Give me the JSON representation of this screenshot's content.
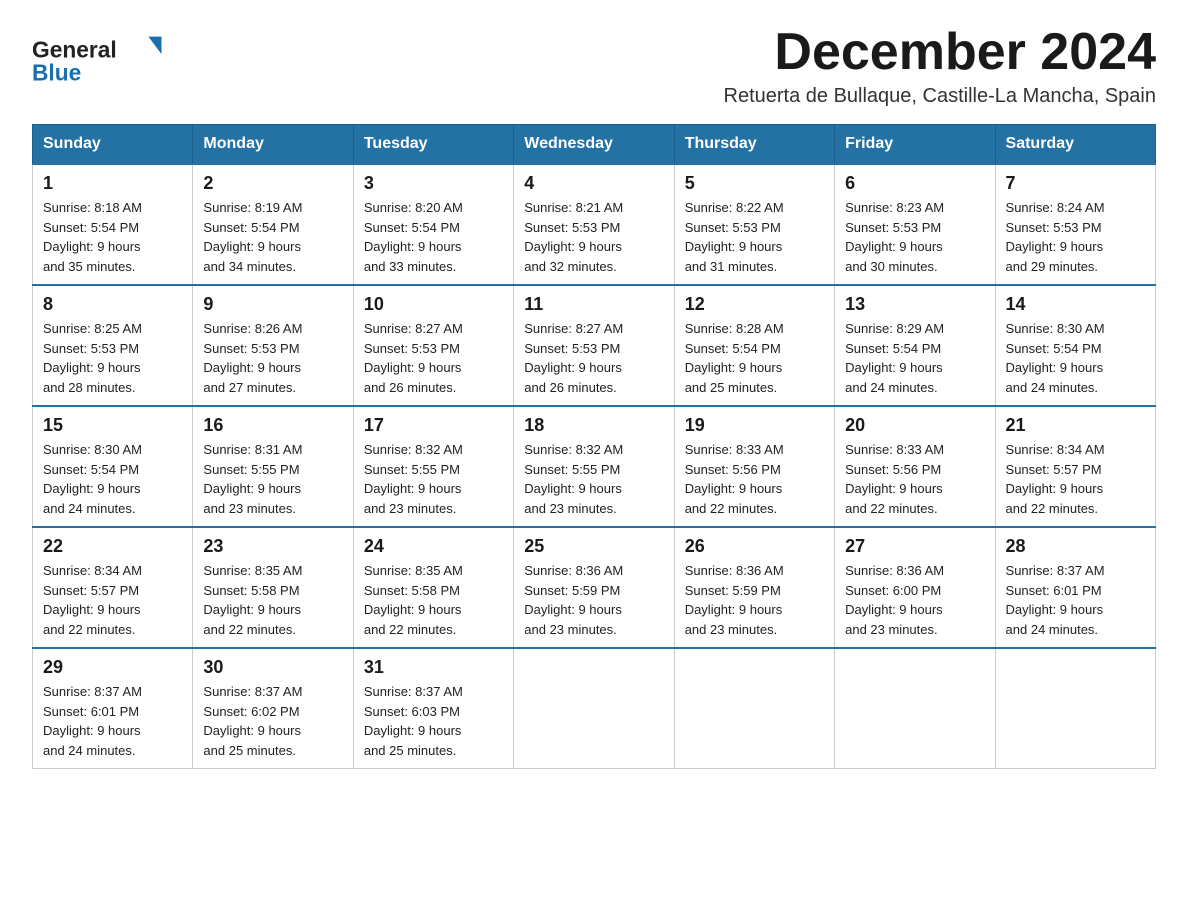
{
  "header": {
    "logo_general": "General",
    "logo_blue": "Blue",
    "title": "December 2024",
    "location": "Retuerta de Bullaque, Castille-La Mancha, Spain"
  },
  "calendar": {
    "days_of_week": [
      "Sunday",
      "Monday",
      "Tuesday",
      "Wednesday",
      "Thursday",
      "Friday",
      "Saturday"
    ],
    "weeks": [
      [
        {
          "day": "1",
          "sunrise": "8:18 AM",
          "sunset": "5:54 PM",
          "daylight": "9 hours and 35 minutes."
        },
        {
          "day": "2",
          "sunrise": "8:19 AM",
          "sunset": "5:54 PM",
          "daylight": "9 hours and 34 minutes."
        },
        {
          "day": "3",
          "sunrise": "8:20 AM",
          "sunset": "5:54 PM",
          "daylight": "9 hours and 33 minutes."
        },
        {
          "day": "4",
          "sunrise": "8:21 AM",
          "sunset": "5:53 PM",
          "daylight": "9 hours and 32 minutes."
        },
        {
          "day": "5",
          "sunrise": "8:22 AM",
          "sunset": "5:53 PM",
          "daylight": "9 hours and 31 minutes."
        },
        {
          "day": "6",
          "sunrise": "8:23 AM",
          "sunset": "5:53 PM",
          "daylight": "9 hours and 30 minutes."
        },
        {
          "day": "7",
          "sunrise": "8:24 AM",
          "sunset": "5:53 PM",
          "daylight": "9 hours and 29 minutes."
        }
      ],
      [
        {
          "day": "8",
          "sunrise": "8:25 AM",
          "sunset": "5:53 PM",
          "daylight": "9 hours and 28 minutes."
        },
        {
          "day": "9",
          "sunrise": "8:26 AM",
          "sunset": "5:53 PM",
          "daylight": "9 hours and 27 minutes."
        },
        {
          "day": "10",
          "sunrise": "8:27 AM",
          "sunset": "5:53 PM",
          "daylight": "9 hours and 26 minutes."
        },
        {
          "day": "11",
          "sunrise": "8:27 AM",
          "sunset": "5:53 PM",
          "daylight": "9 hours and 26 minutes."
        },
        {
          "day": "12",
          "sunrise": "8:28 AM",
          "sunset": "5:54 PM",
          "daylight": "9 hours and 25 minutes."
        },
        {
          "day": "13",
          "sunrise": "8:29 AM",
          "sunset": "5:54 PM",
          "daylight": "9 hours and 24 minutes."
        },
        {
          "day": "14",
          "sunrise": "8:30 AM",
          "sunset": "5:54 PM",
          "daylight": "9 hours and 24 minutes."
        }
      ],
      [
        {
          "day": "15",
          "sunrise": "8:30 AM",
          "sunset": "5:54 PM",
          "daylight": "9 hours and 24 minutes."
        },
        {
          "day": "16",
          "sunrise": "8:31 AM",
          "sunset": "5:55 PM",
          "daylight": "9 hours and 23 minutes."
        },
        {
          "day": "17",
          "sunrise": "8:32 AM",
          "sunset": "5:55 PM",
          "daylight": "9 hours and 23 minutes."
        },
        {
          "day": "18",
          "sunrise": "8:32 AM",
          "sunset": "5:55 PM",
          "daylight": "9 hours and 23 minutes."
        },
        {
          "day": "19",
          "sunrise": "8:33 AM",
          "sunset": "5:56 PM",
          "daylight": "9 hours and 22 minutes."
        },
        {
          "day": "20",
          "sunrise": "8:33 AM",
          "sunset": "5:56 PM",
          "daylight": "9 hours and 22 minutes."
        },
        {
          "day": "21",
          "sunrise": "8:34 AM",
          "sunset": "5:57 PM",
          "daylight": "9 hours and 22 minutes."
        }
      ],
      [
        {
          "day": "22",
          "sunrise": "8:34 AM",
          "sunset": "5:57 PM",
          "daylight": "9 hours and 22 minutes."
        },
        {
          "day": "23",
          "sunrise": "8:35 AM",
          "sunset": "5:58 PM",
          "daylight": "9 hours and 22 minutes."
        },
        {
          "day": "24",
          "sunrise": "8:35 AM",
          "sunset": "5:58 PM",
          "daylight": "9 hours and 22 minutes."
        },
        {
          "day": "25",
          "sunrise": "8:36 AM",
          "sunset": "5:59 PM",
          "daylight": "9 hours and 23 minutes."
        },
        {
          "day": "26",
          "sunrise": "8:36 AM",
          "sunset": "5:59 PM",
          "daylight": "9 hours and 23 minutes."
        },
        {
          "day": "27",
          "sunrise": "8:36 AM",
          "sunset": "6:00 PM",
          "daylight": "9 hours and 23 minutes."
        },
        {
          "day": "28",
          "sunrise": "8:37 AM",
          "sunset": "6:01 PM",
          "daylight": "9 hours and 24 minutes."
        }
      ],
      [
        {
          "day": "29",
          "sunrise": "8:37 AM",
          "sunset": "6:01 PM",
          "daylight": "9 hours and 24 minutes."
        },
        {
          "day": "30",
          "sunrise": "8:37 AM",
          "sunset": "6:02 PM",
          "daylight": "9 hours and 25 minutes."
        },
        {
          "day": "31",
          "sunrise": "8:37 AM",
          "sunset": "6:03 PM",
          "daylight": "9 hours and 25 minutes."
        },
        null,
        null,
        null,
        null
      ]
    ]
  }
}
